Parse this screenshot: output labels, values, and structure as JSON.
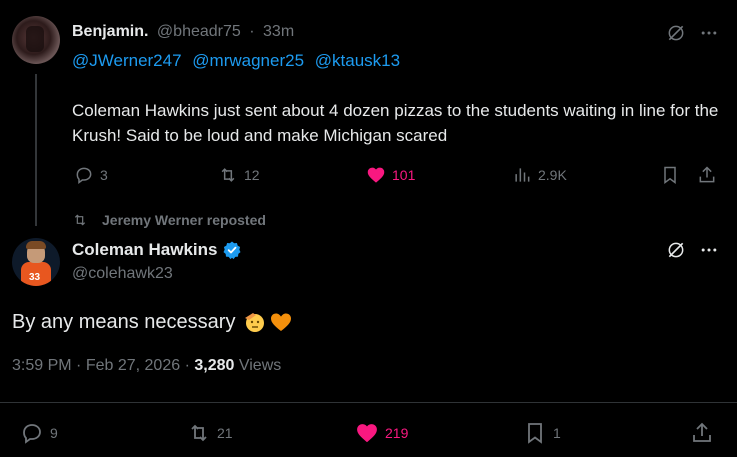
{
  "reply": {
    "name": "Benjamin.",
    "handle": "@bheadr75",
    "separator": "·",
    "time": "33m",
    "mentions": [
      "@JWerner247",
      "@mrwagner25",
      "@ktausk13"
    ],
    "text": "Coleman Hawkins just sent about 4 dozen pizzas to the students waiting in line for the Krush! Said to be loud and make Michigan scared",
    "stats": {
      "replies": "3",
      "reposts": "12",
      "likes": "101",
      "views": "2.9K"
    }
  },
  "repost_label": "Jeremy Werner reposted",
  "post": {
    "name": "Coleman Hawkins",
    "handle": "@colehawk23",
    "avatar_number": "33",
    "text": "By any means necessary",
    "time": "3:59 PM",
    "separator": "·",
    "date": "Feb 27, 2026",
    "views_count": "3,280",
    "views_label": "Views",
    "stats": {
      "replies": "9",
      "reposts": "21",
      "likes": "219",
      "bookmarks": "1"
    }
  },
  "colors": {
    "accent": "#1d9bf0",
    "like": "#f91880",
    "muted": "#71767b",
    "text": "#e7e9ea",
    "background": "#000000"
  },
  "icons": [
    "grok-icon",
    "more-icon",
    "reply-icon",
    "repost-icon",
    "like-icon",
    "views-icon",
    "bookmark-icon",
    "share-icon",
    "verified-badge-icon",
    "saluting-face-emoji",
    "orange-heart-emoji"
  ]
}
